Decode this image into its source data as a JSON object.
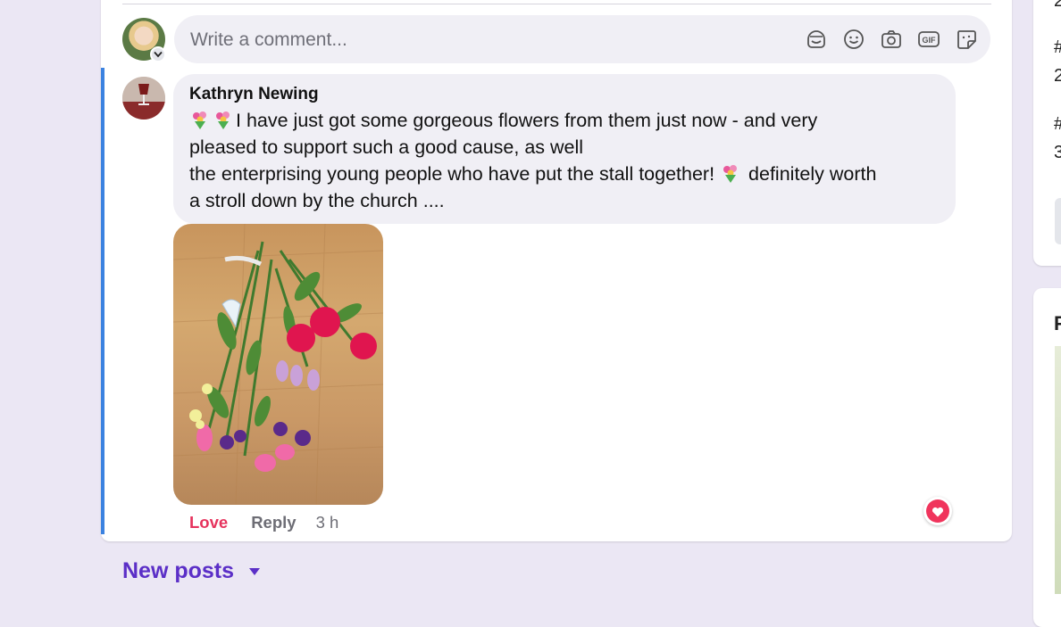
{
  "composer": {
    "placeholder": "Write a comment...",
    "icons": [
      "sticker-face-icon",
      "emoji-icon",
      "camera-icon",
      "gif-icon",
      "sticker-icon"
    ]
  },
  "comment": {
    "author": "Kathryn Newing",
    "lines": [
      "I have just got some gorgeous flowers from them just now - and very",
      "pleased to support such a good cause, as well",
      "the enterprising young people who have put the stall together!",
      "definitely worth",
      "a stroll down by the church ...."
    ],
    "emoji": "bouquet-emoji",
    "actions": {
      "love": "Love",
      "reply": "Reply",
      "time": "3 h"
    },
    "reaction": "heart-reaction"
  },
  "feed": {
    "new_posts": "New posts"
  },
  "right_rail": {
    "fragments": [
      "2",
      "#",
      "2",
      "#",
      "3",
      "F"
    ]
  },
  "colors": {
    "accent": "#5b2fc7",
    "love": "#e6335d",
    "thread": "#3b82e0"
  }
}
